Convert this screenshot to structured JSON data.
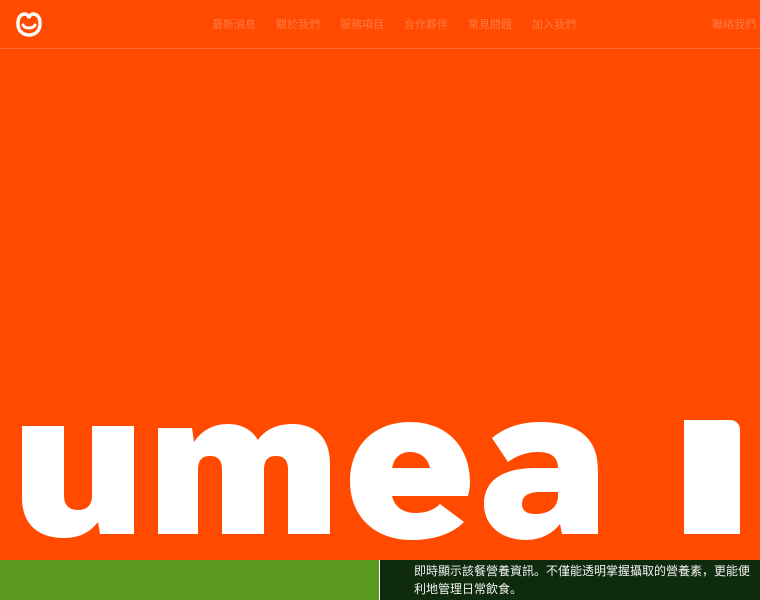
{
  "brand": {
    "logo_icon": "smile-face-logo-icon",
    "accent": "#FF4A00",
    "logo_color": "#FFFFFF"
  },
  "nav": {
    "items": [
      {
        "label": "最新消息"
      },
      {
        "label": "關於我們"
      },
      {
        "label": "服務項目"
      },
      {
        "label": "合作夥伴"
      },
      {
        "label": "常見問題"
      },
      {
        "label": "加入我們"
      }
    ],
    "right_label": "聯絡我們"
  },
  "hero": {
    "word": "umeal",
    "text_color": "#FFFFFF"
  },
  "bottom": {
    "left_color": "#5A9A1E",
    "right_color": "#0F2B0E",
    "description": "即時顯示該餐營養資訊。不僅能透明掌握攝取的營養素，更能便利地管理日常飲食。"
  }
}
